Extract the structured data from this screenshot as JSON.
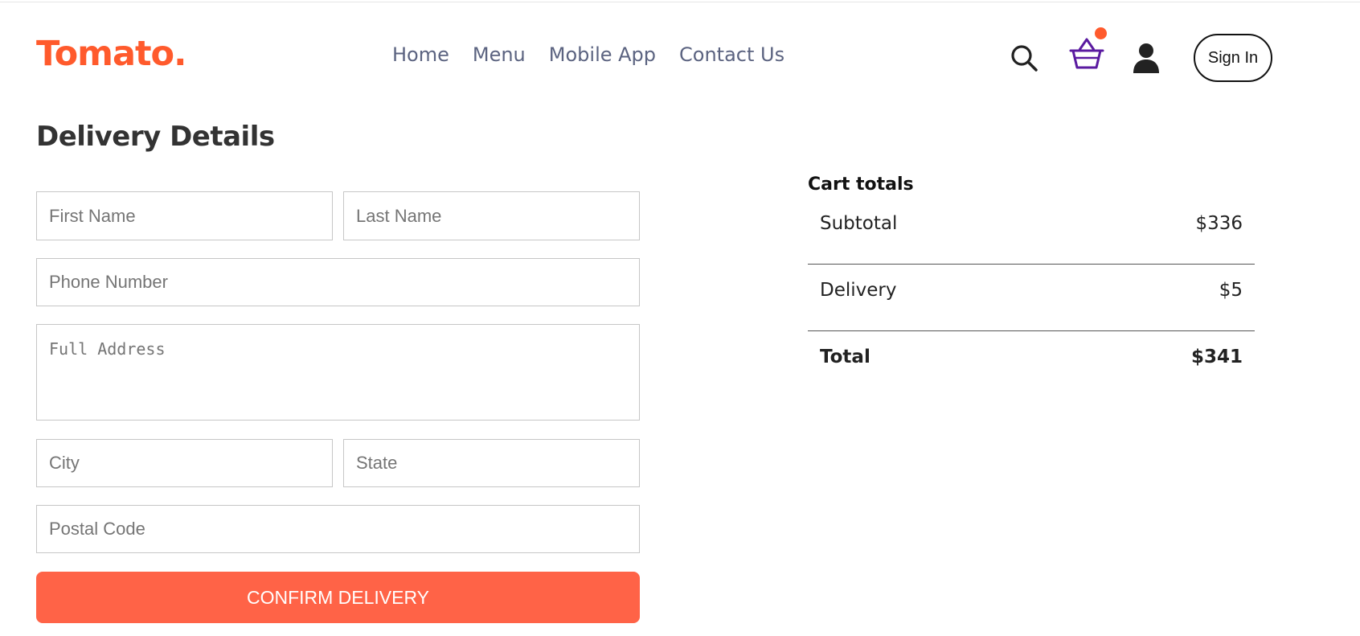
{
  "brand": {
    "logo": "Tomato.",
    "accent_color": "#ff5a2c"
  },
  "nav": {
    "items": [
      {
        "label": "Home"
      },
      {
        "label": "Menu"
      },
      {
        "label": "Mobile App"
      },
      {
        "label": "Contact Us"
      }
    ]
  },
  "header": {
    "icons": [
      "search-icon",
      "basket-icon",
      "user-icon"
    ],
    "cart_has_items": true,
    "signin_label": "Sign In"
  },
  "delivery": {
    "title": "Delivery Details",
    "fields": {
      "first_name": {
        "placeholder": "First Name",
        "value": ""
      },
      "last_name": {
        "placeholder": "Last Name",
        "value": ""
      },
      "phone": {
        "placeholder": "Phone Number",
        "value": ""
      },
      "address": {
        "placeholder": "Full Address",
        "value": ""
      },
      "city": {
        "placeholder": "City",
        "value": ""
      },
      "state": {
        "placeholder": "State",
        "value": ""
      },
      "postal_code": {
        "placeholder": "Postal Code",
        "value": ""
      }
    },
    "confirm_label": "CONFIRM DELIVERY",
    "confirm_color": "#ff6347"
  },
  "cart_totals": {
    "title": "Cart totals",
    "subtotal": {
      "label": "Subtotal",
      "value": "$336"
    },
    "delivery": {
      "label": "Delivery",
      "value": "$5"
    },
    "total": {
      "label": "Total",
      "value": "$341"
    }
  }
}
